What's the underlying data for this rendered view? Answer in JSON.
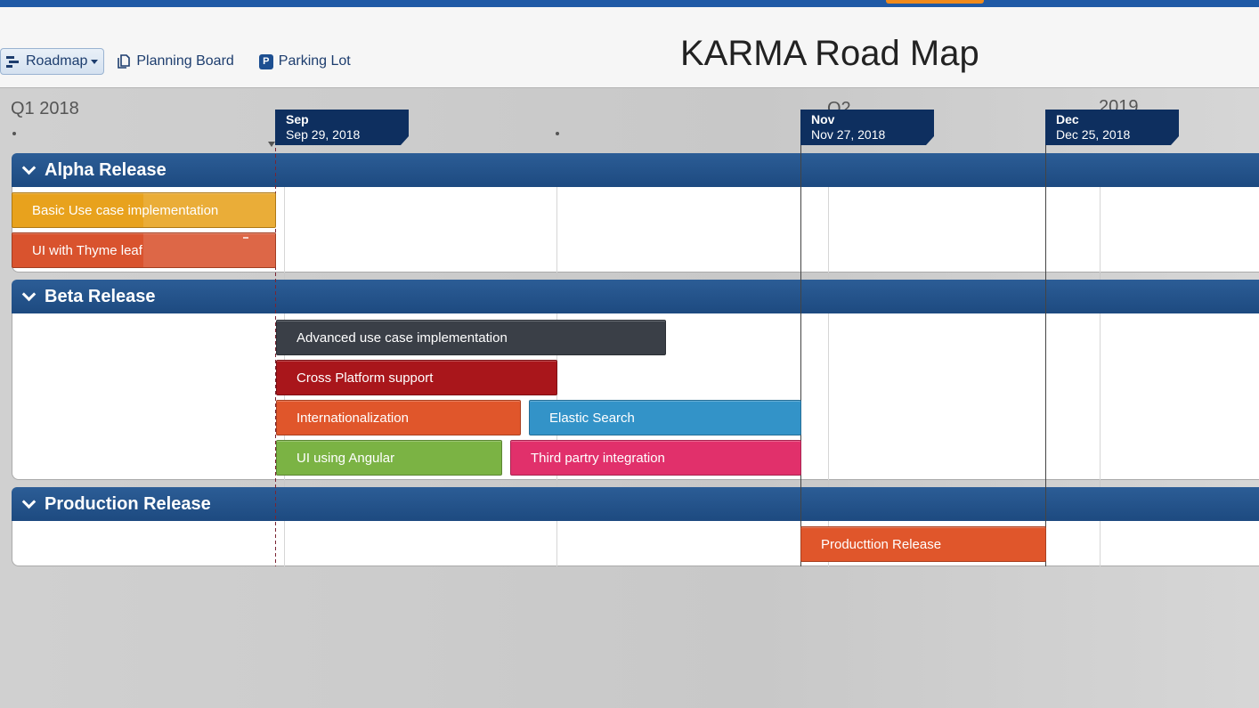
{
  "header": {
    "title": "KARMA Road Map",
    "tabs": [
      {
        "label": "Roadmap",
        "icon": "roadmap-icon",
        "active": true
      },
      {
        "label": "Planning Board",
        "icon": "document-icon"
      },
      {
        "label": "Parking Lot",
        "icon": "parking-icon",
        "icon_text": "P"
      }
    ]
  },
  "timeline": {
    "period_labels": [
      "Q1 2018",
      "Q2",
      "2019"
    ],
    "markers": [
      {
        "month": "Sep",
        "date": "Sep 29, 2018"
      },
      {
        "month": "Nov",
        "date": "Nov 27, 2018"
      },
      {
        "month": "Dec",
        "date": "Dec 25, 2018"
      }
    ]
  },
  "groups": [
    {
      "name": "Alpha Release",
      "items": [
        {
          "label": "Basic Use case implementation",
          "color": "#e8a21d"
        },
        {
          "label": "UI with Thyme leaf",
          "color": "#d9532e"
        }
      ]
    },
    {
      "name": "Beta Release",
      "items": [
        {
          "label": "Advanced use case implementation",
          "color": "#3a3f47"
        },
        {
          "label": "Cross Platform support",
          "color": "#a9161b"
        },
        {
          "label": "Internationalization",
          "color": "#e0562b"
        },
        {
          "label": "Elastic Search",
          "color": "#3393c8"
        },
        {
          "label": "UI using Angular",
          "color": "#7bb344"
        },
        {
          "label": "Third partry integration",
          "color": "#e1306b"
        }
      ]
    },
    {
      "name": "Production Release",
      "items": [
        {
          "label": "Producttion Release",
          "color": "#e0562b"
        }
      ]
    }
  ]
}
